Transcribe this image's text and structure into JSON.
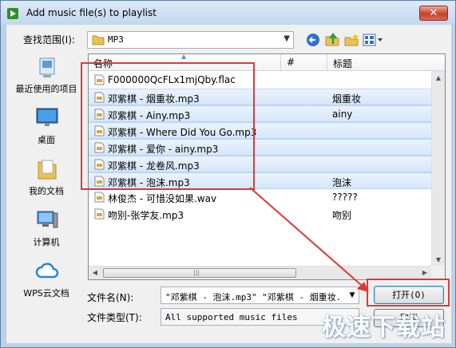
{
  "window": {
    "title": "Add music file(s) to playlist",
    "close_glyph": "✕"
  },
  "lookin": {
    "label": "查找范围(I):",
    "value": "MP3"
  },
  "toolbar": {
    "icons": [
      "back-icon",
      "up-folder-icon",
      "new-folder-icon",
      "view-menu-icon"
    ]
  },
  "places": [
    {
      "label": "最近使用的项目",
      "icon": "recent-items-icon"
    },
    {
      "label": "桌面",
      "icon": "desktop-icon"
    },
    {
      "label": "我的文档",
      "icon": "documents-icon"
    },
    {
      "label": "计算机",
      "icon": "computer-icon"
    },
    {
      "label": "WPS云文档",
      "icon": "wps-cloud-icon"
    }
  ],
  "columns": {
    "name": "名称",
    "number": "#",
    "title": "标题"
  },
  "files": [
    {
      "name": "F000000QcFLx1mjQby.flac",
      "title": "",
      "selected": false
    },
    {
      "name": "邓紫棋 - 烟重妆.mp3",
      "title": "烟重妆",
      "selected": true
    },
    {
      "name": "邓紫棋 - Ainy.mp3",
      "title": "ainy",
      "selected": true
    },
    {
      "name": "邓紫棋 - Where Did You Go.mp3",
      "title": "",
      "selected": true
    },
    {
      "name": "邓紫棋 - 爱你 - ainy.mp3",
      "title": "",
      "selected": true
    },
    {
      "name": "邓紫棋 - 龙卷风.mp3",
      "title": "",
      "selected": true
    },
    {
      "name": "邓紫棋 - 泡沫.mp3",
      "title": "泡沫",
      "selected": true
    },
    {
      "name": "林俊杰 - 可惜没如果.wav",
      "title": "?????",
      "selected": false
    },
    {
      "name": "吻别-张学友.mp3",
      "title": "吻别",
      "selected": false
    }
  ],
  "filename": {
    "label": "文件名(N):",
    "value": "\"邓紫棋 - 泡沫.mp3\" \"邓紫棋 - 烟重妆."
  },
  "filetype": {
    "label": "文件类型(T):",
    "value": "All supported music files"
  },
  "buttons": {
    "open": "打开(O)",
    "cancel": "取消"
  },
  "watermark": "极速下载站",
  "colors": {
    "annotation": "#e0373b",
    "selection": "#d6e6f8"
  }
}
